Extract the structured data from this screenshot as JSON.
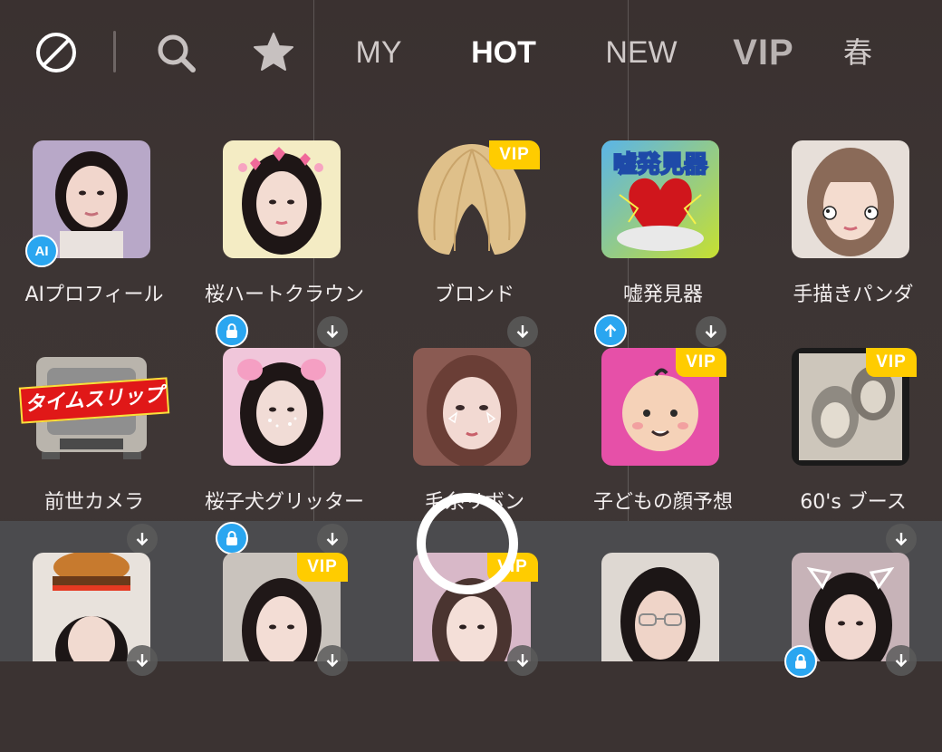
{
  "toolbar": {
    "tabs": [
      "MY",
      "HOT",
      "NEW",
      "VIP",
      "春"
    ],
    "active_tab": "HOT",
    "icons": [
      "no-effect-icon",
      "search-icon",
      "star-icon"
    ]
  },
  "colors": {
    "vip_badge": "#ffcc00",
    "accent_blue": "#2aa6f0",
    "background": "#3b3332",
    "bottom_band": "#4b4b4e"
  },
  "effects": [
    {
      "label": "AIプロフィール",
      "badge": "AI",
      "vip": false,
      "download": false
    },
    {
      "label": "桜ハートクラウン",
      "badge": "lock",
      "vip": false,
      "download": true
    },
    {
      "label": "ブロンド",
      "badge": "",
      "vip": true,
      "vip_text": "VIP",
      "download": true
    },
    {
      "label": "嘘発見器",
      "badge": "update",
      "vip": false,
      "download": true,
      "thumb_text": "嘘発見器"
    },
    {
      "label": "手描きパンダ",
      "badge": "",
      "vip": false,
      "download": false
    },
    {
      "label": "前世カメラ",
      "badge": "",
      "vip": false,
      "download": true,
      "thumb_text": "タイムスリップ"
    },
    {
      "label": "桜子犬グリッター",
      "badge": "lock",
      "vip": false,
      "download": true
    },
    {
      "label": "毛糸リボン",
      "badge": "",
      "vip": false,
      "download": false
    },
    {
      "label": "子どもの顔予想",
      "badge": "",
      "vip": true,
      "vip_text": "VIP",
      "download": false
    },
    {
      "label": "60's ブース",
      "badge": "",
      "vip": true,
      "vip_text": "VIP",
      "download": true
    },
    {
      "label": "",
      "badge": "",
      "vip": false,
      "download": true
    },
    {
      "label": "",
      "badge": "",
      "vip": true,
      "vip_text": "VIP",
      "download": true
    },
    {
      "label": "",
      "badge": "",
      "vip": true,
      "vip_text": "VIP",
      "download": true
    },
    {
      "label": "",
      "badge": "",
      "vip": false,
      "download": false
    },
    {
      "label": "",
      "badge": "lock",
      "vip": false,
      "download": true
    }
  ]
}
